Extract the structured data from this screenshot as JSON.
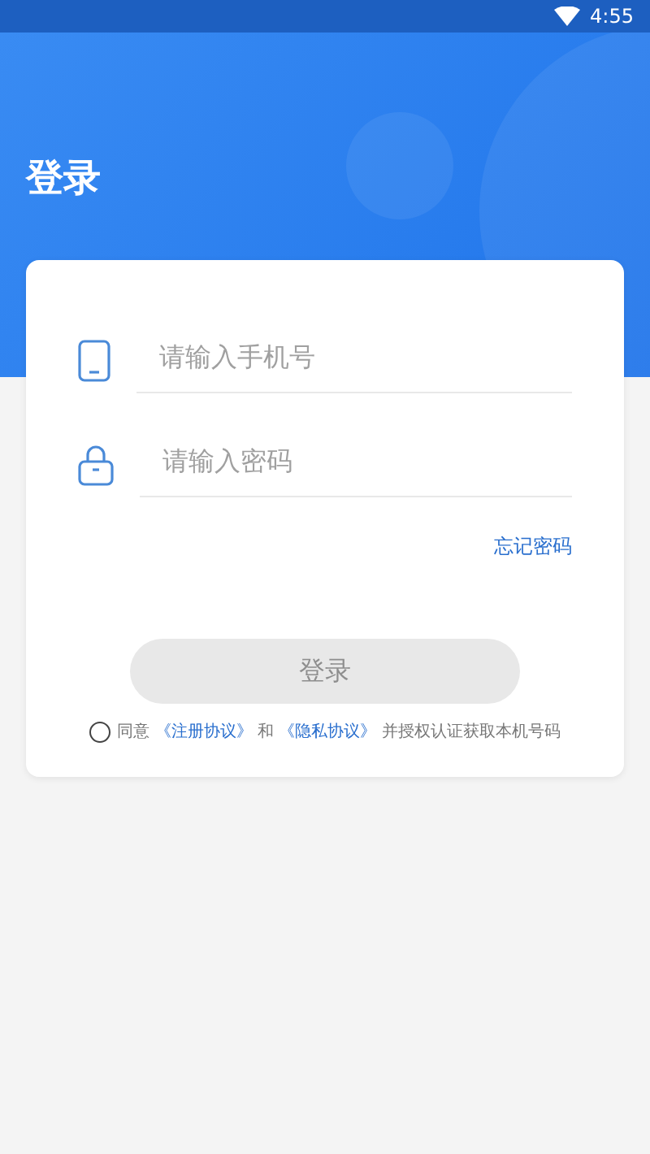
{
  "status_bar": {
    "time": "4:55"
  },
  "title": "登录",
  "fields": [
    {
      "kind": "phone",
      "placeholder": "请输入手机号"
    },
    {
      "kind": "password",
      "placeholder": "请输入密码"
    }
  ],
  "forgot_link": "忘记密码",
  "login_button": {
    "label": "登录",
    "disabled": true
  },
  "agreement": {
    "checked": false,
    "parts": [
      {
        "kind": "text",
        "text": "同意"
      },
      {
        "kind": "link",
        "text": "《注册协议》"
      },
      {
        "kind": "text",
        "text": "和"
      },
      {
        "kind": "link",
        "text": "《隐私协议》"
      },
      {
        "kind": "text",
        "text": "并授权认证获取本机号码"
      }
    ]
  }
}
